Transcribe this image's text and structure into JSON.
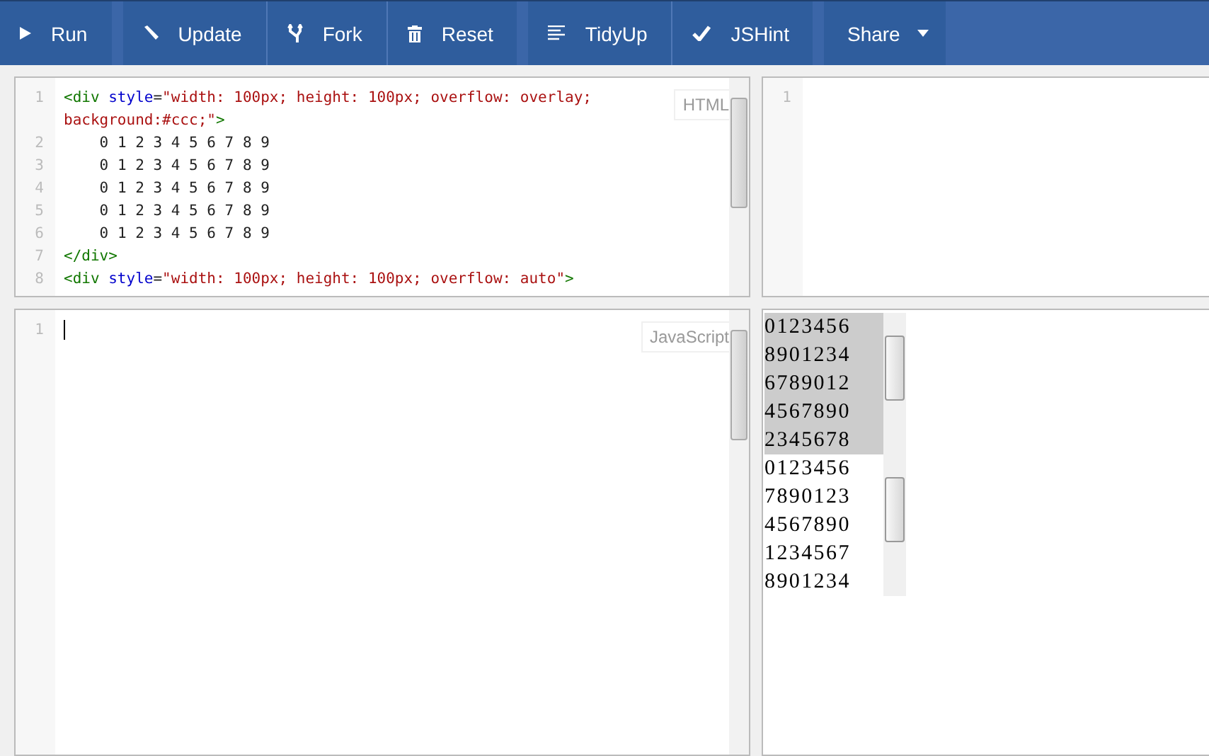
{
  "toolbar": {
    "groups": [
      [
        {
          "label": "Run",
          "kind": "play"
        }
      ],
      [
        {
          "label": "Update",
          "kind": "pencil"
        },
        {
          "label": "Fork",
          "kind": "fork"
        },
        {
          "label": "Reset",
          "kind": "trash"
        }
      ],
      [
        {
          "label": "TidyUp",
          "kind": "lines"
        },
        {
          "label": "JSHint",
          "kind": "check"
        }
      ],
      [
        {
          "label": "Share",
          "kind": "menu"
        }
      ]
    ]
  },
  "html_editor": {
    "mode_label": "HTML",
    "lines": [
      {
        "number": "1",
        "segments": [
          {
            "kind": "tag",
            "text": "<div "
          },
          {
            "kind": "attr",
            "text": "style"
          },
          {
            "kind": "plain",
            "text": "="
          },
          {
            "kind": "string",
            "text": "\"width: 100px; height: 100px; overflow: overlay; background:#ccc;\""
          },
          {
            "kind": "tag",
            "text": ">"
          }
        ]
      },
      {
        "number": "2",
        "segments": [
          {
            "kind": "plain",
            "text": "    0 1 2 3 4 5 6 7 8 9"
          }
        ]
      },
      {
        "number": "3",
        "segments": [
          {
            "kind": "plain",
            "text": "    0 1 2 3 4 5 6 7 8 9"
          }
        ]
      },
      {
        "number": "4",
        "segments": [
          {
            "kind": "plain",
            "text": "    0 1 2 3 4 5 6 7 8 9"
          }
        ]
      },
      {
        "number": "5",
        "segments": [
          {
            "kind": "plain",
            "text": "    0 1 2 3 4 5 6 7 8 9"
          }
        ]
      },
      {
        "number": "6",
        "segments": [
          {
            "kind": "plain",
            "text": "    0 1 2 3 4 5 6 7 8 9"
          }
        ]
      },
      {
        "number": "7",
        "segments": [
          {
            "kind": "tag",
            "text": "</div>"
          }
        ]
      },
      {
        "number": "8",
        "segments": [
          {
            "kind": "tag",
            "text": "<div "
          },
          {
            "kind": "attr",
            "text": "style"
          },
          {
            "kind": "plain",
            "text": "="
          },
          {
            "kind": "string",
            "text": "\"width: 100px; height: 100px; overflow: auto\""
          },
          {
            "kind": "tag",
            "text": ">"
          }
        ]
      }
    ]
  },
  "css_editor": {
    "lines": [
      {
        "number": "1"
      }
    ]
  },
  "js_editor": {
    "mode_label": "JavaScript",
    "lines": [
      {
        "number": "1"
      }
    ]
  },
  "result": {
    "boxes": [
      {
        "kind": "overlay",
        "rows": [
          "0123456",
          "8901234",
          "6789012",
          "4567890",
          "2345678"
        ]
      },
      {
        "kind": "auto",
        "rows": [
          "0123456",
          "7890123",
          "4567890",
          "1234567",
          "8901234"
        ]
      }
    ]
  }
}
